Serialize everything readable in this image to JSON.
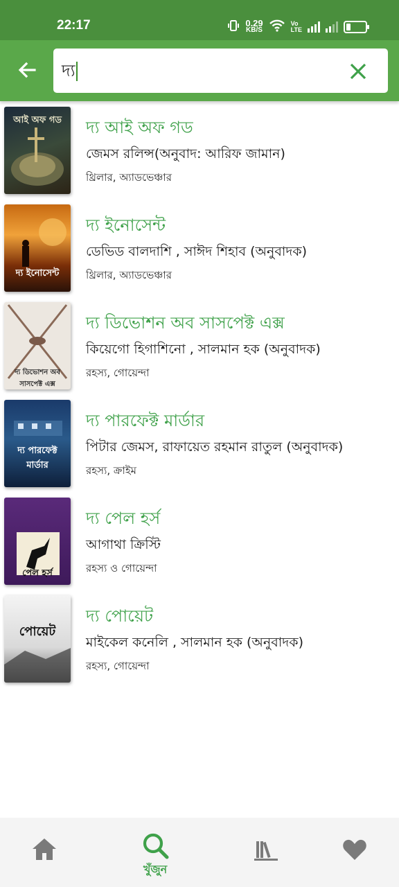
{
  "status_bar": {
    "time": "22:17",
    "net_speed_value": "0.29",
    "net_speed_unit": "KB/S",
    "volte": "Vo",
    "lte": "LTE",
    "battery_level": 0.25
  },
  "header": {
    "back_icon": "arrow-left-icon",
    "search_value": "দ্য",
    "clear_icon": "close-icon",
    "accent": "#5aa84a"
  },
  "books": [
    {
      "title": "দ্য আই অফ গড",
      "author": "জেমস রলিন্স(অনুবাদ: আরিফ জামান)",
      "genre": "থ্রিলার, অ্যাডভেঞ্চার",
      "cover_text": "আই অফ গড"
    },
    {
      "title": "দ্য ইনোসেন্ট",
      "author": "ডেভিড বালদাশি ,  সাঈদ শিহাব (অনুবাদক)",
      "genre": "থ্রিলার, অ্যাডভেঞ্চার",
      "cover_text": "দ্য ইনোসেন্ট"
    },
    {
      "title": "দ্য ডিভোশন অব সাসপেক্ট এক্স",
      "author": "কিয়েগো হিগাশিনো ,  সালমান হক (অনুবাদক)",
      "genre": "রহস্য, গোয়েন্দা",
      "cover_text": "দ্য ডিভোশন অব সাসপেক্ট এক্স"
    },
    {
      "title": "দ্য পারফেক্ট মার্ডার",
      "author": "পিটার জেমস, রাফায়েত রহমান রাতুল (অনুবাদক)",
      "genre": "রহস্য, ক্রাইম",
      "cover_text": "দ্য পারফেক্ট মার্ডার"
    },
    {
      "title": "দ্য পেল হর্স",
      "author": "আগাথা ক্রিস্টি",
      "genre": "রহস্য ও গোয়েন্দা",
      "cover_text": "পেল হর্স"
    },
    {
      "title": "দ্য পোয়েট",
      "author": "মাইকেল কনেলি ,  সালমান হক (অনুবাদক)",
      "genre": "রহস্য, গোয়েন্দা",
      "cover_text": "পোয়েট"
    }
  ],
  "bottom_nav": {
    "items": [
      {
        "icon": "home-icon",
        "label": ""
      },
      {
        "icon": "search-icon",
        "label": "খুঁজুন",
        "active": true
      },
      {
        "icon": "library-icon",
        "label": ""
      },
      {
        "icon": "heart-icon",
        "label": ""
      }
    ],
    "active_color": "#3fa14a",
    "inactive_color": "#7a7a7a"
  }
}
